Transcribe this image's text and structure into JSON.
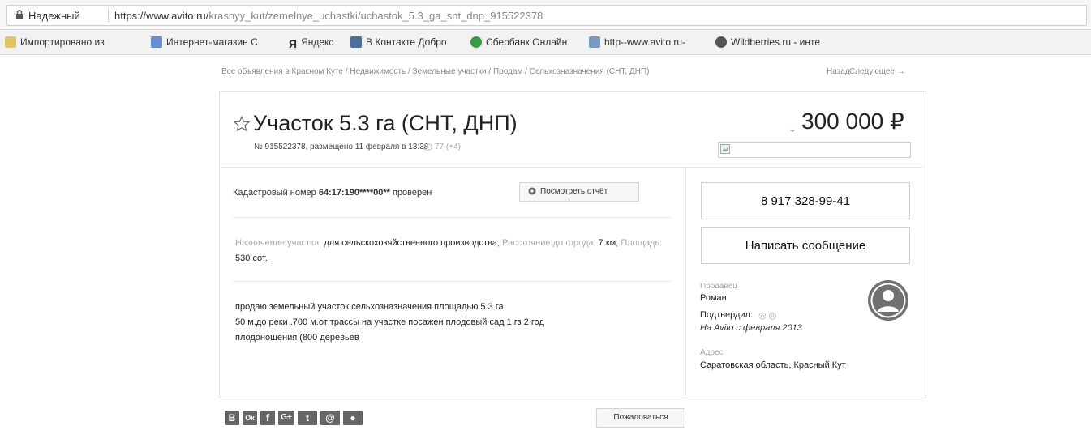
{
  "browser": {
    "secure_label": "Надежный",
    "url_host": "https://www.avito.ru/",
    "url_path": "krasnyy_kut/zemelnye_uchastki/uchastok_5.3_ga_snt_dnp_915522378"
  },
  "bookmarks": [
    {
      "label": "Импортировано из",
      "icon": "folder-icon",
      "color": "#e0c46a"
    },
    {
      "label": "Интернет-магазин С",
      "icon": "shop-icon",
      "color": "#6a8fd0"
    },
    {
      "label": "Яндекс",
      "icon": "yandex-icon",
      "color": "#333333"
    },
    {
      "label": "В Контакте  Добро",
      "icon": "vk-icon",
      "color": "#4a6f9c"
    },
    {
      "label": "Сбербанк Онлайн",
      "icon": "sberbank-icon",
      "color": "#3a9a4a"
    },
    {
      "label": "http--www.avito.ru-",
      "icon": "avito-icon",
      "color": "#7a9ac0"
    },
    {
      "label": "Wildberries.ru - инте",
      "icon": "wildberries-icon",
      "color": "#555555"
    }
  ],
  "breadcrumb": "Все объявления в Красном Куте / Недвижимость / Земельные участки / Продам / Сельхозназначения (СНТ, ДНП)",
  "nav": {
    "back": "Назад",
    "next": "Следующее →"
  },
  "listing": {
    "title": "Участок 5.3 га (СНТ, ДНП)",
    "meta": "№ 915522378, размещено 11 февраля в 13:38",
    "views": "77 (+4)",
    "price_chevron": "⌄",
    "price": "300 000 ₽"
  },
  "cadastral": {
    "prefix": "Кадастровый номер",
    "number": "64:17:190****00**",
    "suffix": "проверен",
    "report_button": "Посмотреть отчёт"
  },
  "params": {
    "purpose_label": "Назначение участка:",
    "purpose_value": "для сельскохозяйственного производства;",
    "distance_label": "Расстояние до города:",
    "distance_value": "7 км;",
    "area_label": "Площадь:",
    "area_value": "530 сот."
  },
  "description": [
    "продаю земельный участок сельхозназначения площадью 5.3 га",
    "50 м.до реки .700 м.от трассы на участке посажен плодовый сад 1 гз 2 год",
    "плодоношения (800 деревьев"
  ],
  "contact": {
    "phone": "8 917 328-99-41",
    "message_button": "Написать сообщение"
  },
  "seller": {
    "label": "Продавец",
    "name": "Роман",
    "confirmed": "Подтвердил:",
    "confirm_icons": "◎ ◎",
    "since": "На Avito с февраля 2013"
  },
  "address": {
    "label": "Адрес",
    "value": "Саратовская область, Красный Кут"
  },
  "share": [
    {
      "label": "B",
      "icon": "vk-share-icon"
    },
    {
      "label": "Ок",
      "icon": "odnoklassniki-share-icon"
    },
    {
      "label": "f",
      "icon": "facebook-share-icon"
    },
    {
      "label": "G+",
      "icon": "google-plus-share-icon"
    },
    {
      "label": "t",
      "icon": "twitter-share-icon"
    },
    {
      "label": "@",
      "icon": "mail-share-icon"
    },
    {
      "label": "●",
      "icon": "livejournal-share-icon"
    }
  ],
  "complain_button": "Пожаловаться"
}
